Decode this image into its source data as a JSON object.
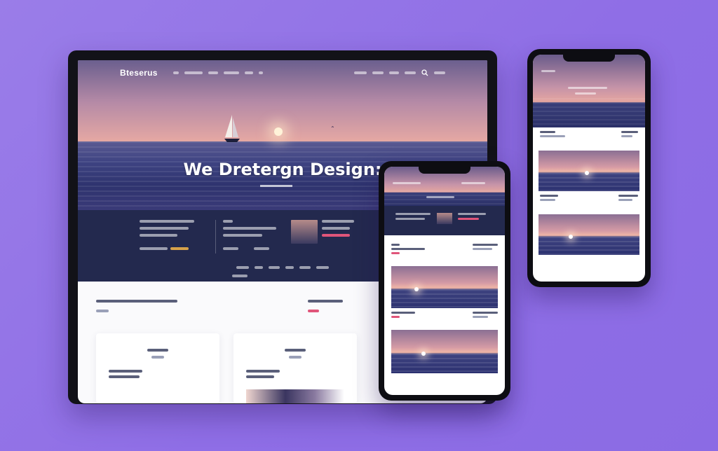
{
  "laptop": {
    "logo": "Bteserus",
    "hero_heading": "We Dretergn Design:"
  },
  "colors": {
    "background": "#9a7de8",
    "dark_band": "#23294e",
    "accent": "#e0557a"
  },
  "icons": {
    "sailboat": "sailboat-icon",
    "bird": "bird-icon"
  }
}
